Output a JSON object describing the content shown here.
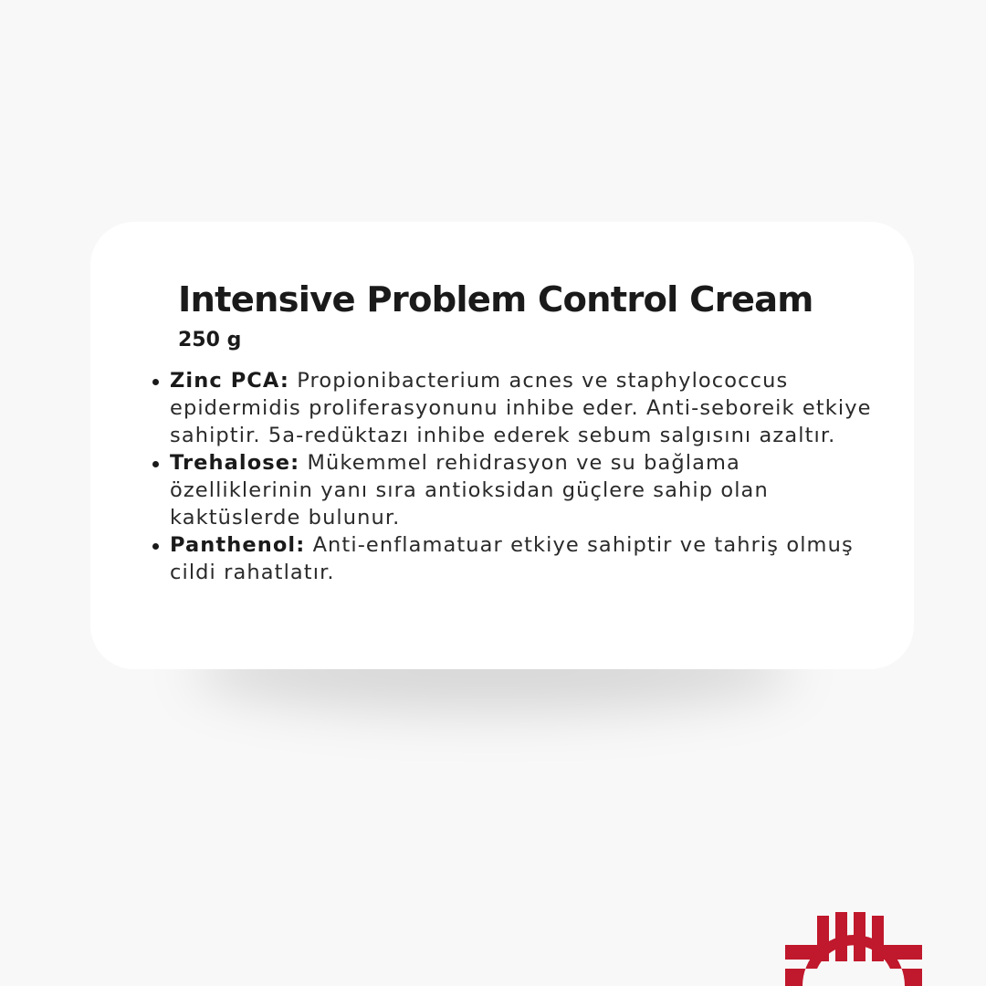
{
  "product": {
    "title": "Intensive Problem Control Cream",
    "size": "250 g"
  },
  "ingredients": [
    {
      "name": "Zinc PCA:",
      "description": " Propionibacterium acnes ve staphylococcus epidermidis proliferasyonunu inhibe eder. Anti-seboreik etkiye sahiptir. 5a-redüktazı inhibe ederek sebum salgısını azaltır."
    },
    {
      "name": "Trehalose:",
      "description": " Mükemmel rehidrasyon ve su bağlama özelliklerinin yanı sıra antioksidan güçlere sahip olan kaktüslerde bulunur."
    },
    {
      "name": "Panthenol:",
      "description": " Anti-enflamatuar etkiye sahiptir ve tahriş olmuş cildi rahatlatır."
    }
  ],
  "brand": {
    "logo_icon": "brand-logo-icon",
    "logo_color": "#c0182c"
  },
  "colors": {
    "background": "#f8f8f8",
    "card": "#ffffff",
    "text": "#1a1a1a"
  }
}
